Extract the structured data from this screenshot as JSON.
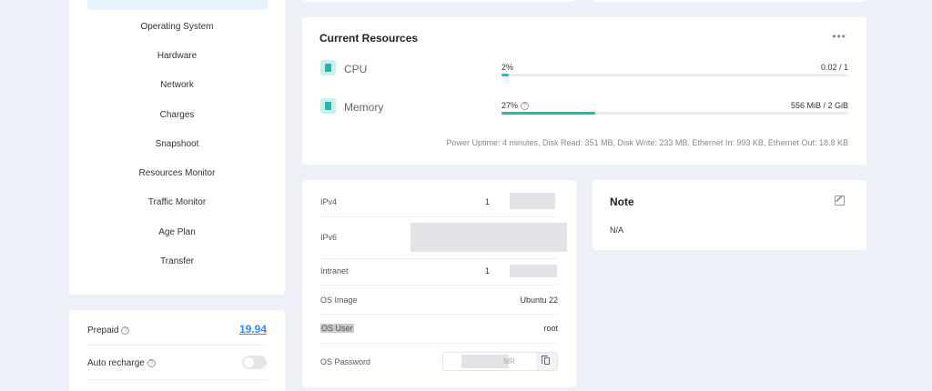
{
  "nav": {
    "items": [
      {
        "label": "Operating System"
      },
      {
        "label": "Hardware"
      },
      {
        "label": "Network"
      },
      {
        "label": "Charges"
      },
      {
        "label": "Snapshoot"
      },
      {
        "label": "Resources Monitor"
      },
      {
        "label": "Traffic Monitor"
      },
      {
        "label": "Age Plan"
      },
      {
        "label": "Transfer"
      }
    ]
  },
  "billing": {
    "prepaid_label": "Prepaid",
    "prepaid_value": "19.94",
    "auto_recharge_label": "Auto recharge",
    "auto_recharge_on": false
  },
  "resources": {
    "title": "Current Resources",
    "more": "•••",
    "cpu": {
      "name": "CPU",
      "percent_text": "2%",
      "percent": 2,
      "value": "0.02 / 1"
    },
    "memory": {
      "name": "Memory",
      "percent_text": "27%",
      "percent": 27,
      "value": "556 MiB / 2 GiB"
    },
    "uptime": "Power Uptime: 4 minutes, Disk Read: 351 MB, Disk Write: 233 MB, Ethernet In: 993 KB, Ethernet Out: 18.8 KB"
  },
  "info": {
    "ipv4_label": "IPv4",
    "ipv4_value": "1",
    "ipv6_label": "IPv6",
    "intranet_label": "Intranet",
    "intranet_value": "1",
    "os_image_label": "OS Image",
    "os_image_value": "Ubuntu 22",
    "os_user_label": "OS User",
    "os_user_value": "root",
    "os_password_label": "OS Password",
    "os_password_partial": "MR"
  },
  "note": {
    "title": "Note",
    "text": "N/A"
  },
  "colors": {
    "accent": "#2f8cf2",
    "bar": "#19c0b1",
    "background": "#eef0f7"
  }
}
